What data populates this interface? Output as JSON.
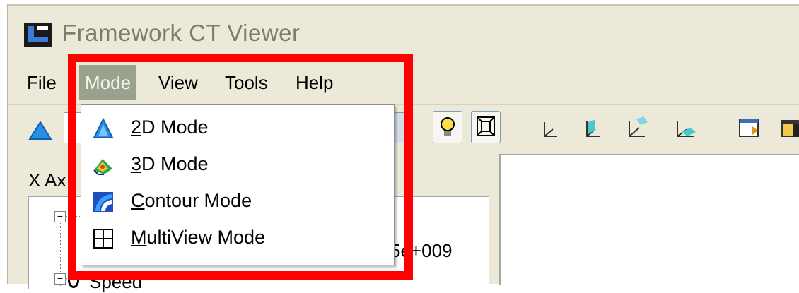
{
  "window": {
    "title": "Framework CT Viewer"
  },
  "menubar": {
    "items": [
      {
        "label": "File"
      },
      {
        "label": "Mode",
        "active": true
      },
      {
        "label": "View"
      },
      {
        "label": "Tools"
      },
      {
        "label": "Help"
      }
    ]
  },
  "mode_menu": {
    "items": [
      {
        "mnemonic": "2",
        "rest": "D Mode",
        "icon": "2d-mode-icon"
      },
      {
        "mnemonic": "3",
        "rest": "D Mode",
        "icon": "3d-mode-icon"
      },
      {
        "mnemonic": "C",
        "rest": "ontour Mode",
        "icon": "contour-mode-icon"
      },
      {
        "mnemonic": "M",
        "rest": "ultiView Mode",
        "icon": "multiview-mode-icon"
      }
    ]
  },
  "left_panel": {
    "axis_label": "X Ax",
    "partial_value": "5e+009",
    "speed_label": "Speed"
  },
  "colors": {
    "highlight": "#ff0000",
    "menu_active_bg": "#9aa28e",
    "window_bg": "#ece9d8"
  }
}
